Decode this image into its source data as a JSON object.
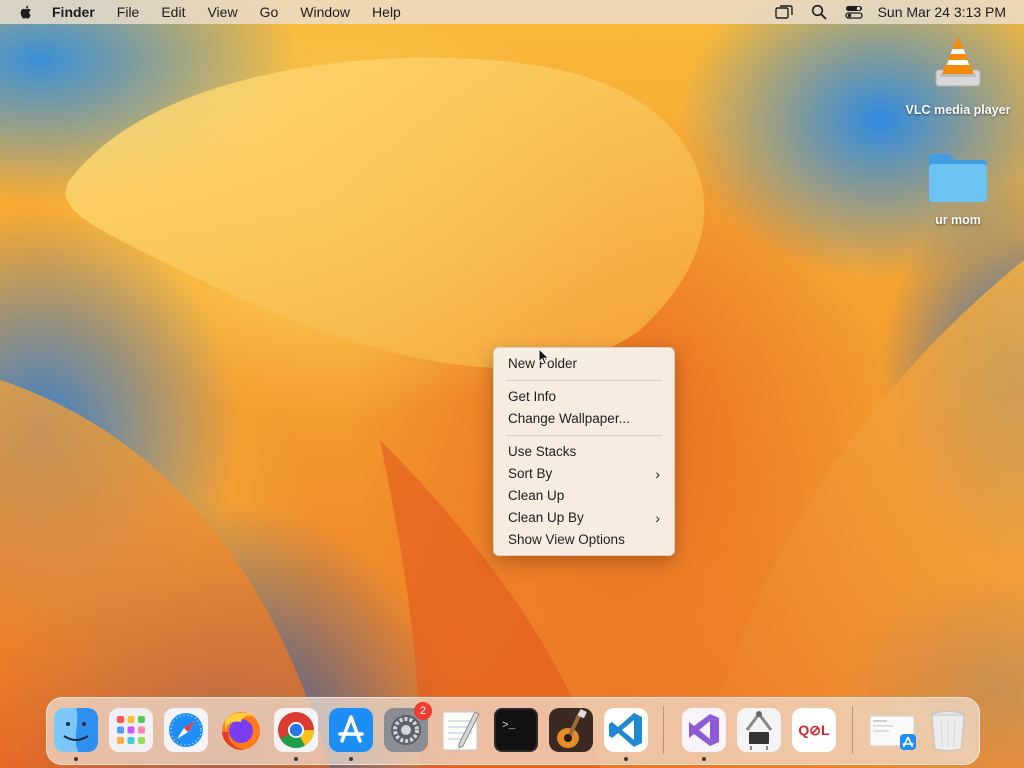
{
  "menubar": {
    "app_name": "Finder",
    "menus": [
      "File",
      "Edit",
      "View",
      "Go",
      "Window",
      "Help"
    ],
    "status_icons": [
      "screen-mirroring-icon",
      "spotlight-search-icon",
      "control-center-icon"
    ],
    "clock": "Sun Mar 24  3:13 PM"
  },
  "desktop": {
    "icons": [
      {
        "label": "VLC media player",
        "icon": "vlc-icon"
      },
      {
        "label": "ur mom",
        "icon": "folder-icon"
      }
    ]
  },
  "context_menu": {
    "items": [
      {
        "label": "New Folder"
      },
      {
        "label": "Get Info"
      },
      {
        "label": "Change Wallpaper..."
      },
      {
        "label": "Use Stacks"
      },
      {
        "label": "Sort By",
        "submenu": true
      },
      {
        "label": "Clean Up"
      },
      {
        "label": "Clean Up By",
        "submenu": true
      },
      {
        "label": "Show View Options"
      }
    ],
    "chevron": "›"
  },
  "dock": {
    "apps": [
      {
        "icon": "finder-icon",
        "running": true
      },
      {
        "icon": "launchpad-icon",
        "running": false
      },
      {
        "icon": "safari-icon",
        "running": false
      },
      {
        "icon": "firefox-icon",
        "running": false
      },
      {
        "icon": "chrome-icon",
        "running": true
      },
      {
        "icon": "app-store-icon",
        "running": true
      },
      {
        "icon": "system-settings-icon",
        "running": false,
        "badge": "2"
      },
      {
        "icon": "textedit-icon",
        "running": false
      },
      {
        "icon": "terminal-icon",
        "running": false
      },
      {
        "icon": "garageband-icon",
        "running": false
      },
      {
        "icon": "vscode-icon",
        "running": true
      },
      {
        "icon": "visual-studio-icon",
        "running": true
      },
      {
        "icon": "system-information-icon",
        "running": false
      },
      {
        "icon": "qol-app-icon",
        "running": false
      },
      {
        "icon": "downloads-stack-icon",
        "running": false
      },
      {
        "icon": "trash-icon",
        "running": false
      }
    ],
    "terminal_prompt": ">_",
    "qol_text": "Q⊘L"
  },
  "colors": {
    "menu_bg": "#ecdecd",
    "badge": "#f03b30",
    "folder_blue": "#5ab8ef",
    "vlc_orange": "#f28a0a"
  }
}
